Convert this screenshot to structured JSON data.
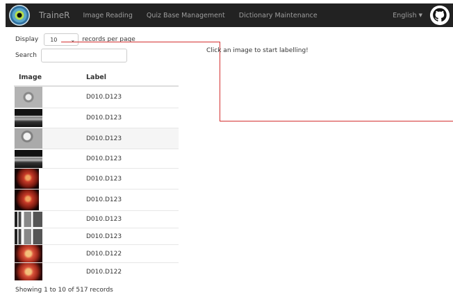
{
  "navbar": {
    "brand": "TraineR",
    "links": [
      "Image Reading",
      "Quiz Base Management",
      "Dictionary Maintenance"
    ],
    "language": "English"
  },
  "table_controls": {
    "display_label": "Display",
    "page_size": "10",
    "per_page_label": "records per page",
    "search_label": "Search",
    "search_value": ""
  },
  "table": {
    "headers": [
      "Image",
      "Label"
    ],
    "rows": [
      {
        "thumb": "gray-scan",
        "label": "D010.D123"
      },
      {
        "thumb": "oct-scan",
        "label": "D010.D123"
      },
      {
        "thumb": "gray-scan",
        "label": "D010.D123"
      },
      {
        "thumb": "oct-scan",
        "label": "D010.D123"
      },
      {
        "thumb": "fundus-photo",
        "label": "D010.D123"
      },
      {
        "thumb": "fundus-photo",
        "label": "D010.D123"
      },
      {
        "thumb": "grid-scan",
        "label": "D010.D123"
      },
      {
        "thumb": "grid-scan",
        "label": "D010.D123"
      },
      {
        "thumb": "fundus-photo",
        "label": "D010.D122"
      },
      {
        "thumb": "fundus-photo",
        "label": "D010.D122"
      }
    ]
  },
  "footer": {
    "info": "Showing 1 to 10 of 517 records"
  },
  "viewer": {
    "hint": "Click an image to start labelling!"
  }
}
